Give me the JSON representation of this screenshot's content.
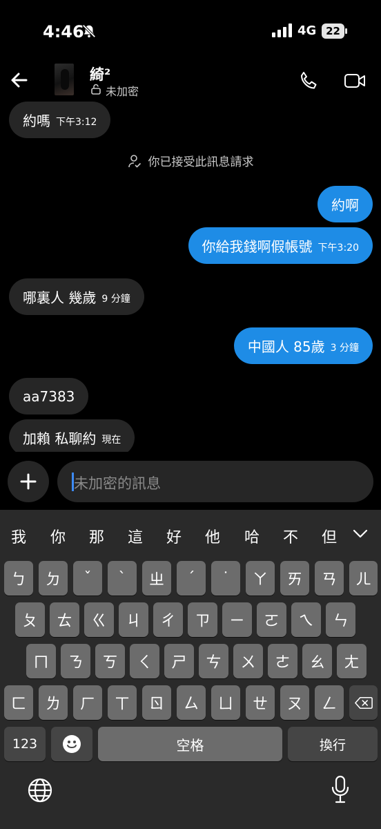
{
  "status": {
    "time": "4:46",
    "network": "4G",
    "battery": "22"
  },
  "header": {
    "contact_name": "綺²",
    "encryption_label": "未加密"
  },
  "messages": [
    {
      "dir": "in",
      "text": "約嗎",
      "time": "下午3:12"
    },
    {
      "dir": "out",
      "text": "約啊",
      "time": ""
    },
    {
      "dir": "out",
      "text": "你給我錢啊假帳號",
      "time": "下午3:20"
    },
    {
      "dir": "in",
      "text": "哪裏人 幾歲",
      "time": "9 分鐘"
    },
    {
      "dir": "out",
      "text": "中國人 85歲",
      "time": "3 分鐘"
    },
    {
      "dir": "in",
      "text": "aa7383",
      "time": ""
    },
    {
      "dir": "in",
      "text": "加賴 私聊約",
      "time": "現在"
    }
  ],
  "system_notice": "你已接受此訊息請求",
  "composer": {
    "placeholder": "未加密的訊息"
  },
  "keyboard": {
    "candidates": [
      "我",
      "你",
      "那",
      "這",
      "好",
      "他",
      "哈",
      "不",
      "但"
    ],
    "row1": [
      "ㄅ",
      "ㄉ",
      "ˇ",
      "ˋ",
      "ㄓ",
      "ˊ",
      "˙",
      "ㄚ",
      "ㄞ",
      "ㄢ",
      "ㄦ"
    ],
    "row2": [
      "ㄆ",
      "ㄊ",
      "ㄍ",
      "ㄐ",
      "ㄔ",
      "ㄗ",
      "ㄧ",
      "ㄛ",
      "ㄟ",
      "ㄣ"
    ],
    "row3": [
      "ㄇ",
      "ㄋ",
      "ㄎ",
      "ㄑ",
      "ㄕ",
      "ㄘ",
      "ㄨ",
      "ㄜ",
      "ㄠ",
      "ㄤ"
    ],
    "row4": [
      "ㄈ",
      "ㄌ",
      "ㄏ",
      "ㄒ",
      "ㄖ",
      "ㄙ",
      "ㄩ",
      "ㄝ",
      "ㄡ",
      "ㄥ"
    ],
    "numbers_label": "123",
    "space_label": "空格",
    "return_label": "換行"
  }
}
